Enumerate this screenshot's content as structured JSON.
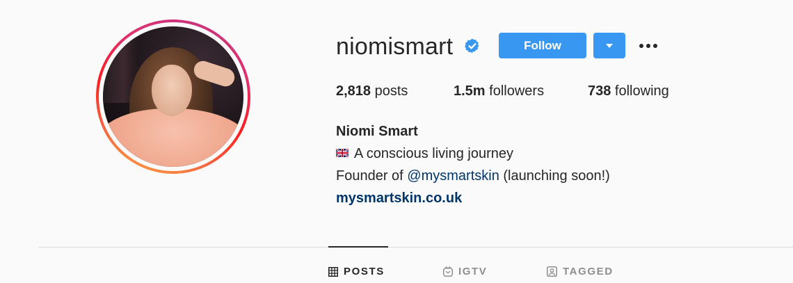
{
  "profile": {
    "username": "niomismart",
    "verified": true,
    "avatar_icon": "profile-photo",
    "follow_label": "Follow",
    "dropdown_icon": "caret-down-icon",
    "more_icon": "more-horizontal-icon"
  },
  "stats": {
    "posts_count": "2,818",
    "posts_label": " posts",
    "followers_count": "1.5m",
    "followers_label": " followers",
    "following_count": "738",
    "following_label": " following"
  },
  "bio": {
    "full_name": "Niomi Smart",
    "flag_icon": "uk-flag-icon",
    "line1_text": "A conscious living journey",
    "line2_prefix": "Founder of ",
    "line2_mention": "@mysmartskin",
    "line2_suffix": " (launching soon!)",
    "website": "mysmartskin.co.uk"
  },
  "tabs": [
    {
      "label": "POSTS",
      "icon": "grid-icon",
      "active": true
    },
    {
      "label": "IGTV",
      "icon": "igtv-icon",
      "active": false
    },
    {
      "label": "TAGGED",
      "icon": "tagged-icon",
      "active": false
    }
  ],
  "colors": {
    "accent_blue": "#3897f0",
    "link_blue": "#003569",
    "text": "#262626",
    "muted": "#8e8e8e",
    "background": "#fafafa"
  }
}
